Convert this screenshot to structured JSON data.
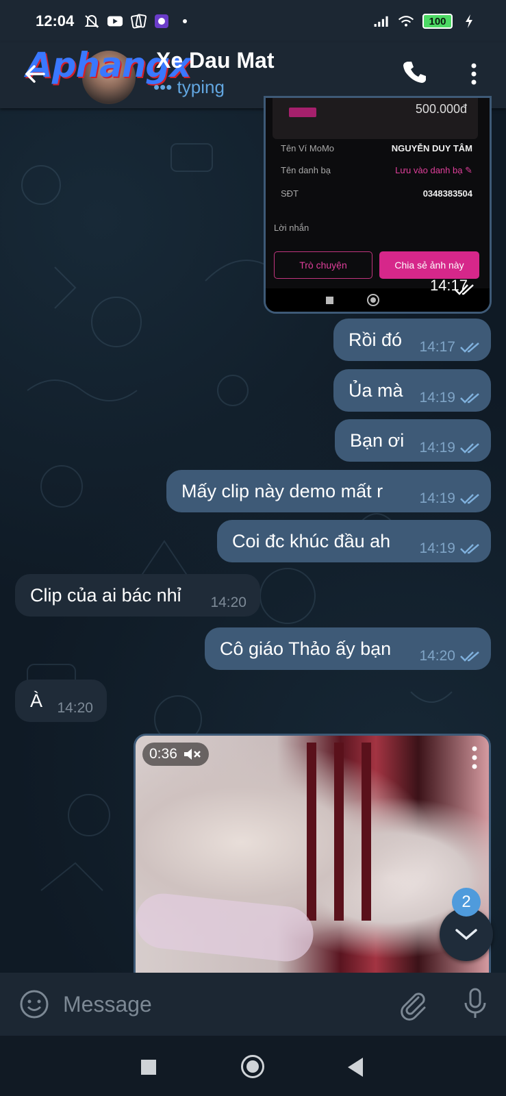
{
  "status_bar": {
    "time": "12:04",
    "battery": "100",
    "icons": [
      "mute-icon",
      "youtube-icon",
      "cards-icon",
      "app-icon",
      "dot-icon",
      "signal-icon",
      "wifi-icon",
      "battery-icon",
      "charging-icon"
    ]
  },
  "header": {
    "watermark": "Aphangx",
    "contact_name": "Xe Dau Mat",
    "status_text": "typing",
    "icons": [
      "back-arrow-icon",
      "phone-icon",
      "more-vertical-icon"
    ]
  },
  "forwarded_screenshot": {
    "amount": "500.000đ",
    "rows": [
      {
        "label": "Tên Ví MoMo",
        "value": "NGUYỄN DUY TÂM"
      },
      {
        "label": "Tên danh bạ",
        "value": "Lưu vào danh bạ"
      },
      {
        "label": "SĐT",
        "value": "0348383504"
      }
    ],
    "note_label": "Lời nhắn",
    "button_chat": "Trò chuyện",
    "button_share": "Chia sẻ ảnh này",
    "time": "14:17"
  },
  "messages": [
    {
      "direction": "out",
      "text": "Rồi đó",
      "time": "14:17"
    },
    {
      "direction": "out",
      "text": "Ủa mà",
      "time": "14:19"
    },
    {
      "direction": "out",
      "text": "Bạn ơi",
      "time": "14:19"
    },
    {
      "direction": "out",
      "text": "Mấy clip này demo mất r",
      "time": "14:19"
    },
    {
      "direction": "out",
      "text": "Coi đc khúc đầu ah",
      "time": "14:19"
    },
    {
      "direction": "in",
      "text": "Clip của ai bác nhỉ",
      "time": "14:20"
    },
    {
      "direction": "out",
      "text": "Cô giáo Thảo ấy bạn",
      "time": "14:20"
    },
    {
      "direction": "in",
      "text": "À",
      "time": "14:20"
    }
  ],
  "video": {
    "duration": "0:36",
    "muted": true
  },
  "unread_count": "2",
  "composer": {
    "placeholder": "Message"
  },
  "colors": {
    "outgoing_bubble": "#3e5a77",
    "incoming_bubble": "#1f2b38",
    "accent": "#62a6e0",
    "momo_pink": "#d6278a"
  }
}
